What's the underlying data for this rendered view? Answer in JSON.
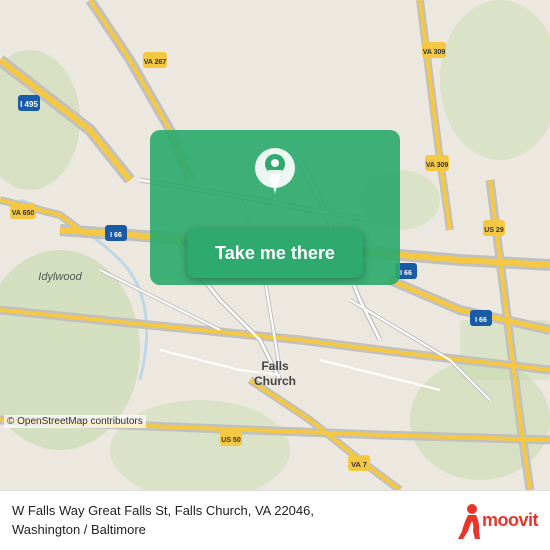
{
  "map": {
    "alt": "Map of W Falls Way Great Falls St, Falls Church, VA 22046"
  },
  "button": {
    "label": "Take me there"
  },
  "attribution": {
    "text": "© OpenStreetMap contributors"
  },
  "infobar": {
    "address": "W Falls Way Great Falls St, Falls Church, VA 22046,",
    "region": "Washington / Baltimore"
  },
  "moovit": {
    "name": "moovit"
  }
}
